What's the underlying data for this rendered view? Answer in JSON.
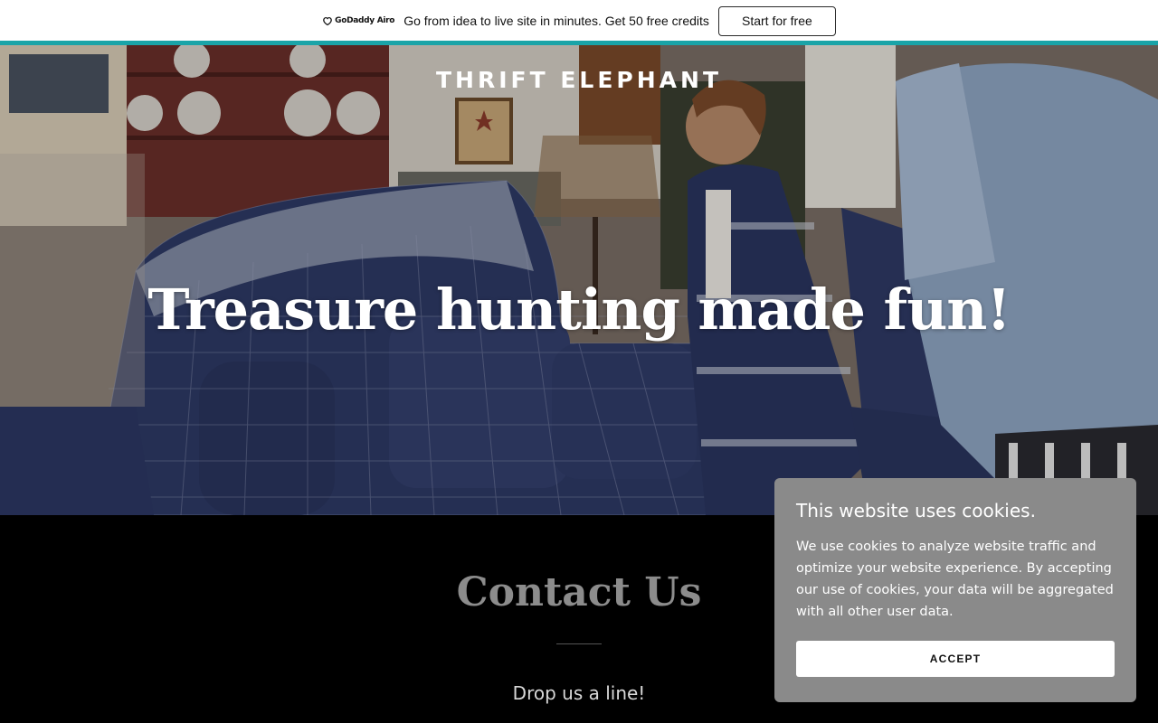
{
  "promo": {
    "logo_text": "GoDaddy Airo",
    "message": "Go from idea to live site in minutes. Get 50 free credits",
    "cta_label": "Start for free",
    "accent_color": "#1aa4a8"
  },
  "hero": {
    "brand": "THRIFT ELEPHANT",
    "title": "Treasure hunting made fun!"
  },
  "contact": {
    "title": "Contact Us",
    "subtitle": "Drop us a line!"
  },
  "cookie_banner": {
    "title": "This website uses cookies.",
    "body": "We use cookies to analyze website traffic and optimize your website experience. By accepting our use of cookies, your data will be aggregated with all other user data.",
    "accept_label": "ACCEPT",
    "background_color": "#8a8a8a"
  }
}
